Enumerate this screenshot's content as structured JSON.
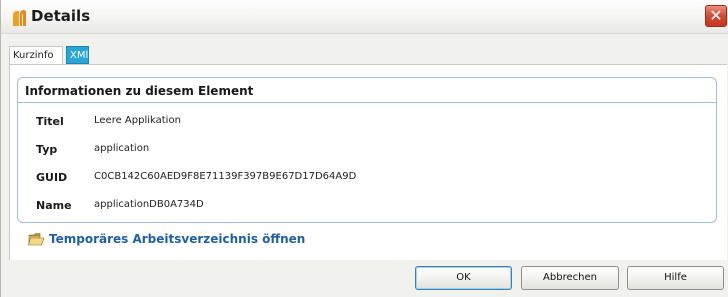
{
  "window": {
    "title": "Details",
    "close_label": "✕"
  },
  "tabs": [
    {
      "label": "Kurzinfo",
      "active": true
    },
    {
      "label": "XMl",
      "active": false
    }
  ],
  "info": {
    "heading": "Informationen zu diesem Element",
    "rows": [
      {
        "label": "Titel",
        "value": "Leere Applikation"
      },
      {
        "label": "Typ",
        "value": "application"
      },
      {
        "label": "GUID",
        "value": "C0CB142C60AED9F8E71139F397B9E67D17D64A9D"
      },
      {
        "label": "Name",
        "value": "applicationDB0A734D"
      }
    ]
  },
  "open_folder_link": "Temporäres Arbeitsverzeichnis öffnen",
  "buttons": {
    "ok": "OK",
    "cancel": "Abbrechen",
    "help": "Hilfe"
  },
  "colors": {
    "tab_active_bg": "#2aa6d6",
    "link": "#1f5fa8",
    "group_border": "#9fc0d6",
    "close_button": "#d34a33"
  },
  "icons": {
    "app": "app-logo-icon",
    "close": "close-icon",
    "folder": "folder-open-icon"
  }
}
